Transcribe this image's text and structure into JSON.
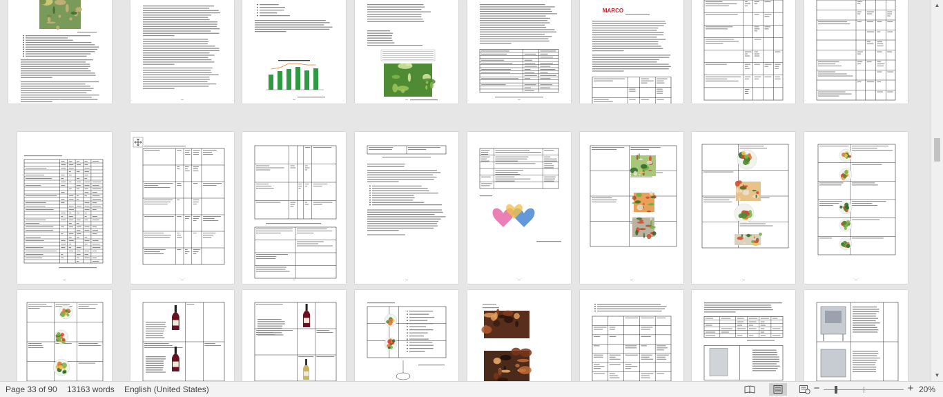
{
  "status": {
    "page_info": "Page 33 of 90",
    "word_count": "13163 words",
    "language": "English (United States)",
    "zoom": "20%",
    "zoom_minus": "−",
    "zoom_plus": "+"
  },
  "views": [
    "read-mode-icon",
    "print-layout-icon",
    "web-layout-icon"
  ],
  "active_view": "print-layout-icon",
  "doc_images": {
    "logo_text": "MARCO"
  },
  "colors": {
    "chart_green": "#2e9a44",
    "salad_green": "#4f8a34",
    "wine_red": "#6a1020",
    "graffiti_pink": "#e76aa8",
    "graffiti_blue": "#3c7fd0",
    "marco_red": "#c8202a"
  }
}
